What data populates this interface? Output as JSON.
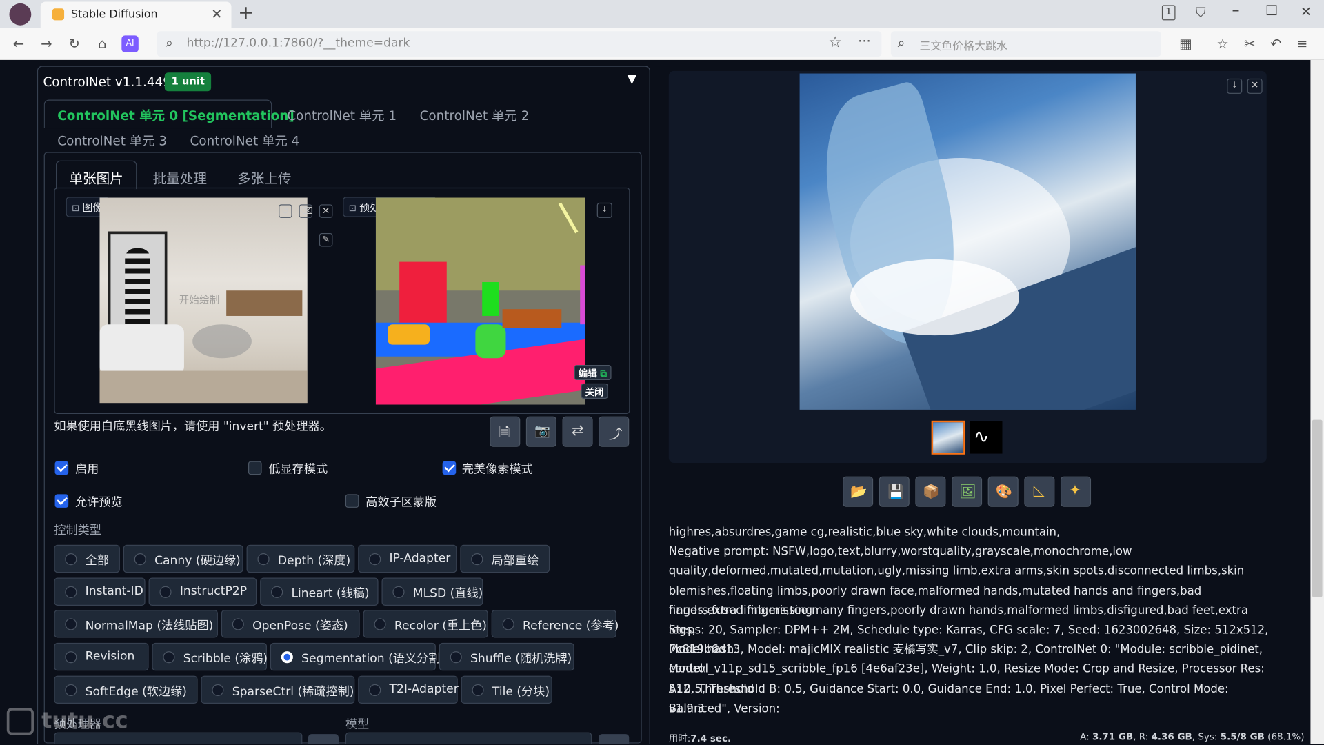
{
  "browser": {
    "tab_title": "Stable Diffusion",
    "url": "http://127.0.0.1:7860/?__theme=dark",
    "search_placeholder": "三文鱼价格大跳水",
    "tab_count": "1"
  },
  "controlnet": {
    "title": "ControlNet v1.1.449",
    "badge": "1 unit",
    "unit_tabs": [
      "ControlNet 单元 0 [Segmentation]",
      "ControlNet 单元 1",
      "ControlNet 单元 2",
      "ControlNet 单元 3",
      "ControlNet 单元 4"
    ],
    "mode_tabs": [
      "单张图片",
      "批量处理",
      "多张上传"
    ],
    "image_label": "图像",
    "image_watermark": "开始绘制",
    "preview_label": "预处理结果预览",
    "edit_label": "编辑",
    "close_label": "关闭",
    "hint": "如果使用白底黑线图片，请使用 \"invert\" 预处理器。",
    "checks": {
      "enable": "启用",
      "lowvram": "低显存模式",
      "pixel_perfect": "完美像素模式",
      "allow_preview": "允许预览",
      "effective_mask": "高效子区蒙版"
    },
    "control_type_label": "控制类型",
    "control_types": [
      [
        "全部",
        "Canny (硬边缘)",
        "Depth (深度)",
        "IP-Adapter",
        "局部重绘"
      ],
      [
        "Instant-ID",
        "InstructP2P",
        "Lineart (线稿)",
        "MLSD (直线)"
      ],
      [
        "NormalMap (法线贴图)",
        "OpenPose (姿态)",
        "Recolor (重上色)",
        "Reference (参考)"
      ],
      [
        "Revision",
        "Scribble (涂鸦)",
        "Segmentation (语义分割)",
        "Shuffle (随机洗牌)"
      ],
      [
        "SoftEdge (软边缘)",
        "SparseCtrl (稀疏控制)",
        "T2I-Adapter",
        "Tile (分块)"
      ]
    ],
    "selected_type": "Segmentation (语义分割)",
    "preprocessor_label": "预处理器",
    "model_label": "模型"
  },
  "output": {
    "info_lines": [
      "highres,absurdres,game cg,realistic,blue sky,white clouds,mountain,",
      "Negative prompt: NSFW,logo,text,blurry,worstquality,grayscale,monochrome,low",
      "quality,deformed,mutated,mutation,ugly,missing limb,extra arms,skin spots,disconnected limbs,skin",
      "blemishes,floating limbs,poorly drawn face,malformed hands,mutated hands and fingers,bad hands,extra limb,missing",
      "fingers,fused fingers,too many fingers,poorly drawn hands,malformed limbs,disfigured,bad feet,extra legs,",
      "Steps: 20, Sampler: DPM++ 2M, Schedule type: Karras, CFG scale: 7, Seed: 1623002648, Size: 512x512, Model hash:",
      "7c819b6d13, Model: majicMIX realistic 麦橘写实_v7, Clip skip: 2, ControlNet 0: \"Module: scribble_pidinet, Model:",
      "control_v11p_sd15_scribble_fp16 [4e6af23e], Weight: 1.0, Resize Mode: Crop and Resize, Processor Res: 512, Threshold",
      "A: 0.5, Threshold B: 0.5, Guidance Start: 0.0, Guidance End: 1.0, Pixel Perfect: True, Control Mode: Balanced\", Version:",
      "v1.9.3"
    ],
    "time_label": "用时:",
    "time_value": "7.4 sec.",
    "mem_a_label": "A: ",
    "mem_a": "3.71 GB",
    "mem_r_label": ", R: ",
    "mem_r": "4.36 GB",
    "mem_sys_label": ", Sys: ",
    "mem_sys": "5.5/8 GB",
    "mem_pct": "(68.1%)"
  },
  "watermark": "tutu.cc",
  "colors": {
    "accent": "#22c55e",
    "selected": "#2563eb",
    "bg": "#0b0f19"
  }
}
